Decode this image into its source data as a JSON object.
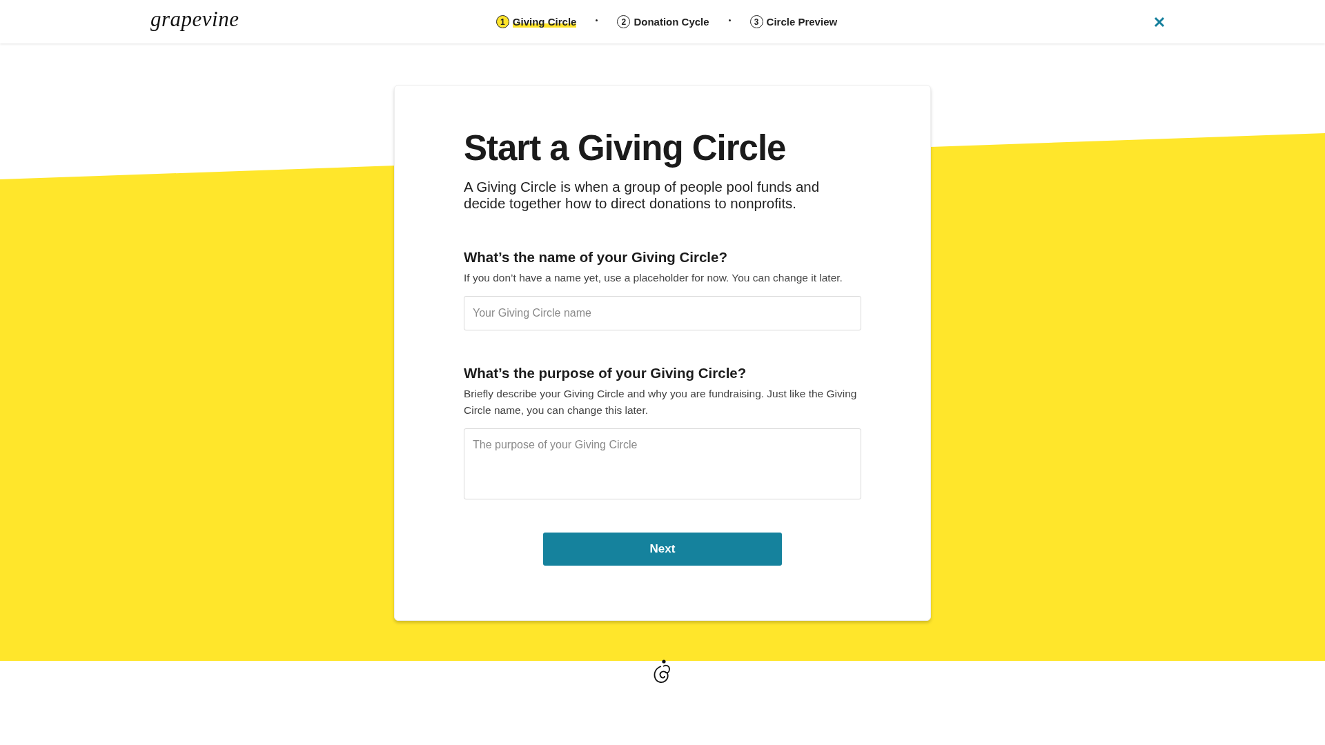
{
  "header": {
    "logo": "grapevine",
    "steps": [
      {
        "number": "1",
        "label": "Giving Circle",
        "selected": true
      },
      {
        "number": "2",
        "label": "Donation Cycle",
        "selected": false
      },
      {
        "number": "3",
        "label": "Circle Preview",
        "selected": false
      }
    ]
  },
  "form": {
    "title": "Start a Giving Circle",
    "intro": "A Giving Circle is when a group of people pool funds and decide together how to direct donations to nonprofits.",
    "fields": [
      {
        "kind": "input",
        "question": "What’s the name of your Giving Circle?",
        "help": "If you don’t have a name yet, use a placeholder for now. You can change it later.",
        "placeholder": "Your Giving Circle name"
      },
      {
        "kind": "textarea",
        "question": "What’s the purpose of your Giving Circle?",
        "help": "Briefly describe your Giving Circle and why you are fundraising. Just like the Giving Circle name, you can change this later.",
        "placeholder": "The purpose of your Giving Circle"
      }
    ],
    "button": "Next"
  }
}
